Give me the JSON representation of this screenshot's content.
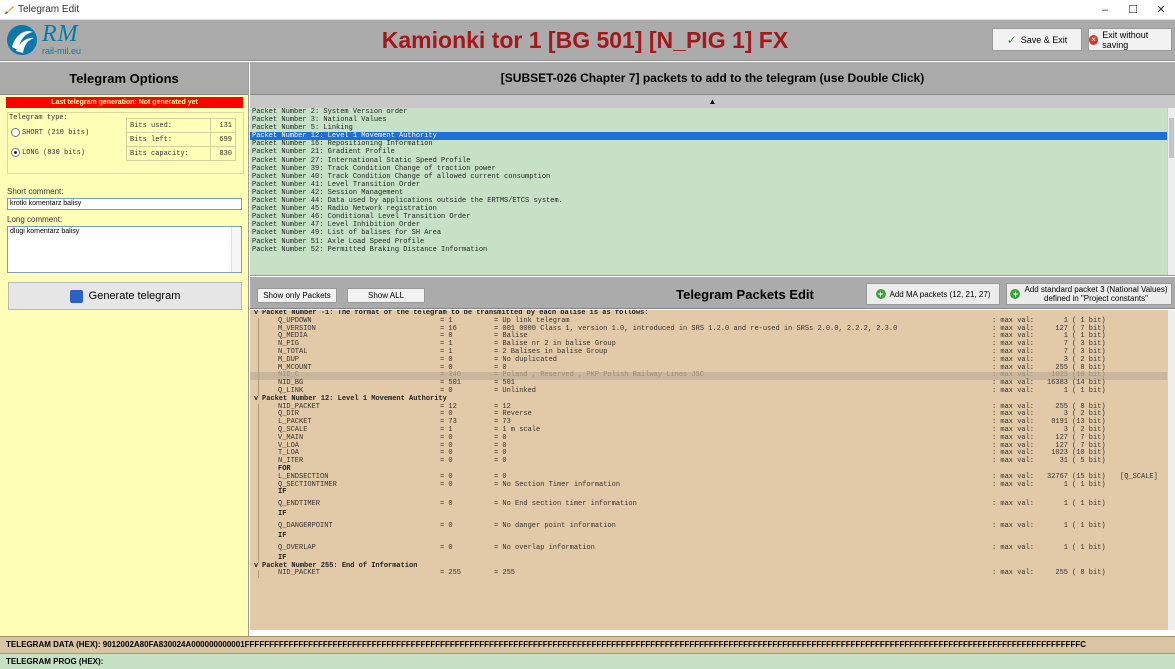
{
  "window": {
    "title": "Telegram Edit",
    "minimize": "–",
    "maximize": "☐",
    "close": "✕"
  },
  "header": {
    "logo_text": "RM",
    "logo_url": "rail-mil.eu",
    "title": "Kamionki tor 1 [BG 501] [N_PIG 1] FX",
    "save_label": "Save & Exit",
    "exit_label": "Exit without saving"
  },
  "left": {
    "title": "Telegram Options",
    "generation_status": "Last telegram generation: Not generated yet",
    "telegram_type_label": "Telegram type:",
    "short_option": "SHORT (210 bits)",
    "long_option": "LONG  (830 bits)",
    "selected_type": "LONG",
    "bits": [
      {
        "label": "Bits used:",
        "value": "131"
      },
      {
        "label": "Bits left:",
        "value": "699"
      },
      {
        "label": "Bits capacity:",
        "value": "830"
      }
    ],
    "short_comment_label": "Short comment:",
    "short_comment_value": "krotki komentarz balisy",
    "long_comment_label": "Long comment:",
    "long_comment_value": "dlugi komentarz balisy",
    "generate_label": "Generate telegram"
  },
  "packets_panel": {
    "title": "[SUBSET-026 Chapter 7] packets to add to the telegram (use Double Click)",
    "up_arrow": "▲",
    "items": [
      "Packet Number 2: System Version order",
      "Packet Number 3: National Values",
      "Packet Number 5: Linking",
      "Packet Number 12: Level 1 Movement Authority",
      "Packet Number 16: Repositioning Information",
      "Packet Number 21: Gradient Profile",
      "Packet Number 27: International Static Speed Profile",
      "Packet Number 39: Track Condition Change of traction power",
      "Packet Number 40: Track Condition Change of allowed current consumption",
      "Packet Number 41: Level Transition Order",
      "Packet Number 42: Session Management",
      "Packet Number 44: Data used by applications outside the ERTMS/ETCS system.",
      "Packet Number 45: Radio Network registration",
      "Packet Number 46: Conditional Level Transition Order",
      "Packet Number 47: Level Inhibition Order",
      "Packet Number 49: List of balises for SH Area",
      "Packet Number 51: Axle Load Speed Profile",
      "Packet Number 52: Permitted Braking Distance Information"
    ],
    "selected_index": 3
  },
  "edit_panel": {
    "show_only_packets": "Show only Packets",
    "show_all": "Show ALL",
    "title": "Telegram Packets Edit",
    "add_ma_label": "Add MA packets (12, 21, 27)",
    "add_std_label_1": "Add standard packet 3 (National Values)",
    "add_std_label_2": "defined in \"Project constants\""
  },
  "tree": [
    {
      "kind": "hdr",
      "arrow": "v",
      "text": "Packet Number -1: The format of the telegram to be transmitted by each balise is as follows:"
    },
    {
      "name": "Q_UPDOWN",
      "eq": "= 1",
      "desc": "= Up link telegram",
      "max": ": max val:",
      "mv": "1",
      "bits": "( 1 bit)"
    },
    {
      "name": "M_VERSION",
      "eq": "= 16",
      "desc": "= 001 0000 Class 1, version 1.0, introduced in SRS 1.2.0 and re-used in SRSs 2.0.0, 2.2.2, 2.3.0",
      "max": ": max val:",
      "mv": "127",
      "bits": "( 7 bit)"
    },
    {
      "name": "Q_MEDIA",
      "eq": "= 0",
      "desc": "= Balise",
      "max": ": max val:",
      "mv": "1",
      "bits": "( 1 bit)"
    },
    {
      "name": "N_PIG",
      "eq": "= 1",
      "desc": "= Balise nr 2 in balise Group",
      "max": ": max val:",
      "mv": "7",
      "bits": "( 3 bit)"
    },
    {
      "name": "N_TOTAL",
      "eq": "= 1",
      "desc": "= 2 Balises in balise Group",
      "max": ": max val:",
      "mv": "7",
      "bits": "( 3 bit)"
    },
    {
      "name": "M_DUP",
      "eq": "= 0",
      "desc": "= No duplicated",
      "max": ": max val:",
      "mv": "3",
      "bits": "( 2 bit)"
    },
    {
      "name": "M_MCOUNT",
      "eq": "= 0",
      "desc": "= 0",
      "max": ": max val:",
      "mv": "255",
      "bits": "( 8 bit)"
    },
    {
      "kind": "gray",
      "name": "NID_C",
      "eq": "= 340",
      "desc": "= Poland , Reserved , PKP Polish Railway Lines JSC",
      "max": ": max val:",
      "mv": "1023",
      "bits": "(10 bit)"
    },
    {
      "name": "NID_BG",
      "eq": "= 501",
      "desc": "= 501",
      "max": ": max val:",
      "mv": "16383",
      "bits": "(14 bit)"
    },
    {
      "name": "Q_LINK",
      "eq": "= 0",
      "desc": "= Unlinked",
      "max": ": max val:",
      "mv": "1",
      "bits": "( 1 bit)"
    },
    {
      "kind": "hdr",
      "arrow": "v",
      "text": "Packet Number 12: Level 1 Movement Authority"
    },
    {
      "name": "NID_PACKET",
      "eq": "= 12",
      "desc": "= 12",
      "max": ": max val:",
      "mv": "255",
      "bits": "( 8 bit)"
    },
    {
      "name": "Q_DIR",
      "eq": "= 0",
      "desc": "= Reverse",
      "max": ": max val:",
      "mv": "3",
      "bits": "( 2 bit)"
    },
    {
      "name": "L_PACKET",
      "eq": "= 73",
      "desc": "= 73",
      "max": ": max val:",
      "mv": "8191",
      "bits": "(13 bit)"
    },
    {
      "name": "Q_SCALE",
      "eq": "= 1",
      "desc": "= 1 m scale",
      "max": ": max val:",
      "mv": "3",
      "bits": "( 2 bit)"
    },
    {
      "name": "V_MAIN",
      "eq": "= 0",
      "desc": "= 0",
      "max": ": max val:",
      "mv": "127",
      "bits": "( 7 bit)"
    },
    {
      "name": "V_LOA",
      "eq": "= 0",
      "desc": "= 0",
      "max": ": max val:",
      "mv": "127",
      "bits": "( 7 bit)"
    },
    {
      "name": "T_LOA",
      "eq": "= 0",
      "desc": "= 0",
      "max": ": max val:",
      "mv": "1023",
      "bits": "(10 bit)"
    },
    {
      "name": "N_ITER",
      "eq": "= 0",
      "desc": "= 0",
      "max": ": max val:",
      "mv": "31",
      "bits": "( 5 bit)"
    },
    {
      "kind": "kw",
      "name": "FOR"
    },
    {
      "name": "L_ENDSECTION",
      "eq": "= 0",
      "desc": "= 0",
      "max": ": max val:",
      "mv": "32767",
      "bits": "(15 bit)",
      "extra": "[Q_SCALE]"
    },
    {
      "name": "Q_SECTIONTIMER",
      "eq": "= 0",
      "desc": "= No Section Timer information",
      "max": ": max val:",
      "mv": "1",
      "bits": "( 1 bit)"
    },
    {
      "kind": "kw",
      "name": "IF"
    },
    {
      "kind": "tall",
      "name": "Q_ENDTIMER",
      "eq": "= 0",
      "desc": "= No End section timer information",
      "max": ": max val:",
      "mv": "1",
      "bits": "( 1 bit)"
    },
    {
      "kind": "kw",
      "name": "IF"
    },
    {
      "kind": "tall",
      "name": "Q_DANGERPOINT",
      "eq": "= 0",
      "desc": "= No danger point information",
      "max": ": max val:",
      "mv": "1",
      "bits": "( 1 bit)"
    },
    {
      "kind": "kw",
      "name": "IF"
    },
    {
      "kind": "tall",
      "name": "Q_OVERLAP",
      "eq": "= 0",
      "desc": "= No overlap information",
      "max": ": max val:",
      "mv": "1",
      "bits": "( 1 bit)"
    },
    {
      "kind": "kw",
      "name": "IF"
    },
    {
      "kind": "hdr",
      "arrow": "v",
      "text": "Packet Number 255: End of Information"
    },
    {
      "name": "NID_PACKET",
      "eq": "= 255",
      "desc": "= 255",
      "max": ": max val:",
      "mv": "255",
      "bits": "( 8 bit)"
    }
  ],
  "footer": {
    "hex_label": "TELEGRAM DATA (HEX):",
    "hex_value": "9012002A80FA830024A000000000001FFFFFFFFFFFFFFFFFFFFFFFFFFFFFFFFFFFFFFFFFFFFFFFFFFFFFFFFFFFFFFFFFFFFFFFFFFFFFFFFFFFFFFFFFFFFFFFFFFFFFFFFFFFFFFFFFFFFFFFFFFFFFFFFFFFFFFFFFFFFFFFFFFFFFFFFFFFFFFFFFFFFFFFFFFFC",
    "prog_label": "TELEGRAM PROG (HEX):"
  }
}
